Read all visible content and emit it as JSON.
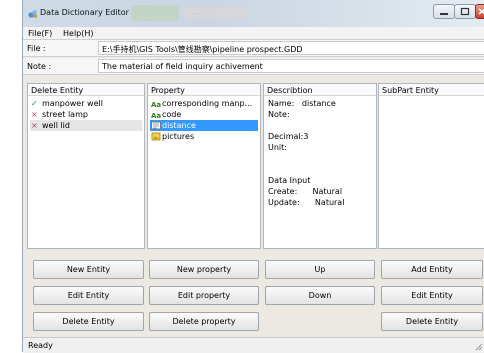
{
  "window": {
    "title": "Data Dictionary Editor",
    "blurred_text": "...",
    "status": "Ready"
  },
  "menu": [
    "File(F)",
    "Help(H)"
  ],
  "fields": {
    "file_label": "File :",
    "file_value": "E:\\手持机\\GIS Tools\\管线勘察\\pipeline prospect.GDD",
    "note_label": "Note :",
    "note_value": "The material of field inquiry achivement"
  },
  "panes": {
    "entities": {
      "header": "Delete Entity",
      "items": [
        {
          "label": "manpower well",
          "mark": "✓"
        },
        {
          "label": "street lamp",
          "mark": "×"
        },
        {
          "label": "well lid",
          "mark": "×"
        }
      ]
    },
    "properties": {
      "header": "Property",
      "items": [
        {
          "label": "corresponding manp..."
        },
        {
          "label": "code"
        },
        {
          "label": "distance"
        },
        {
          "label": "pictures"
        }
      ]
    },
    "description": {
      "header": "Describtion",
      "lines": [
        "Name:   distance",
        "Note:",
        "",
        "Decimal:3",
        "Unit:",
        "",
        "",
        "Data Input",
        "Create:      Natural",
        "Update:      Natural"
      ]
    },
    "subpart": {
      "header": "SubPart Entity"
    }
  },
  "buttons": {
    "new_entity": "New Entity",
    "edit_entity": "Edit Entity",
    "delete_entity": "Delete Entity",
    "new_property": "New property",
    "edit_property": "Edit property",
    "delete_property": "Delete property",
    "up": "Up",
    "down": "Down",
    "add_entity": "Add Entity",
    "edit_subentity": "Edit Entity",
    "delete_subentity": "Delete Entity"
  }
}
